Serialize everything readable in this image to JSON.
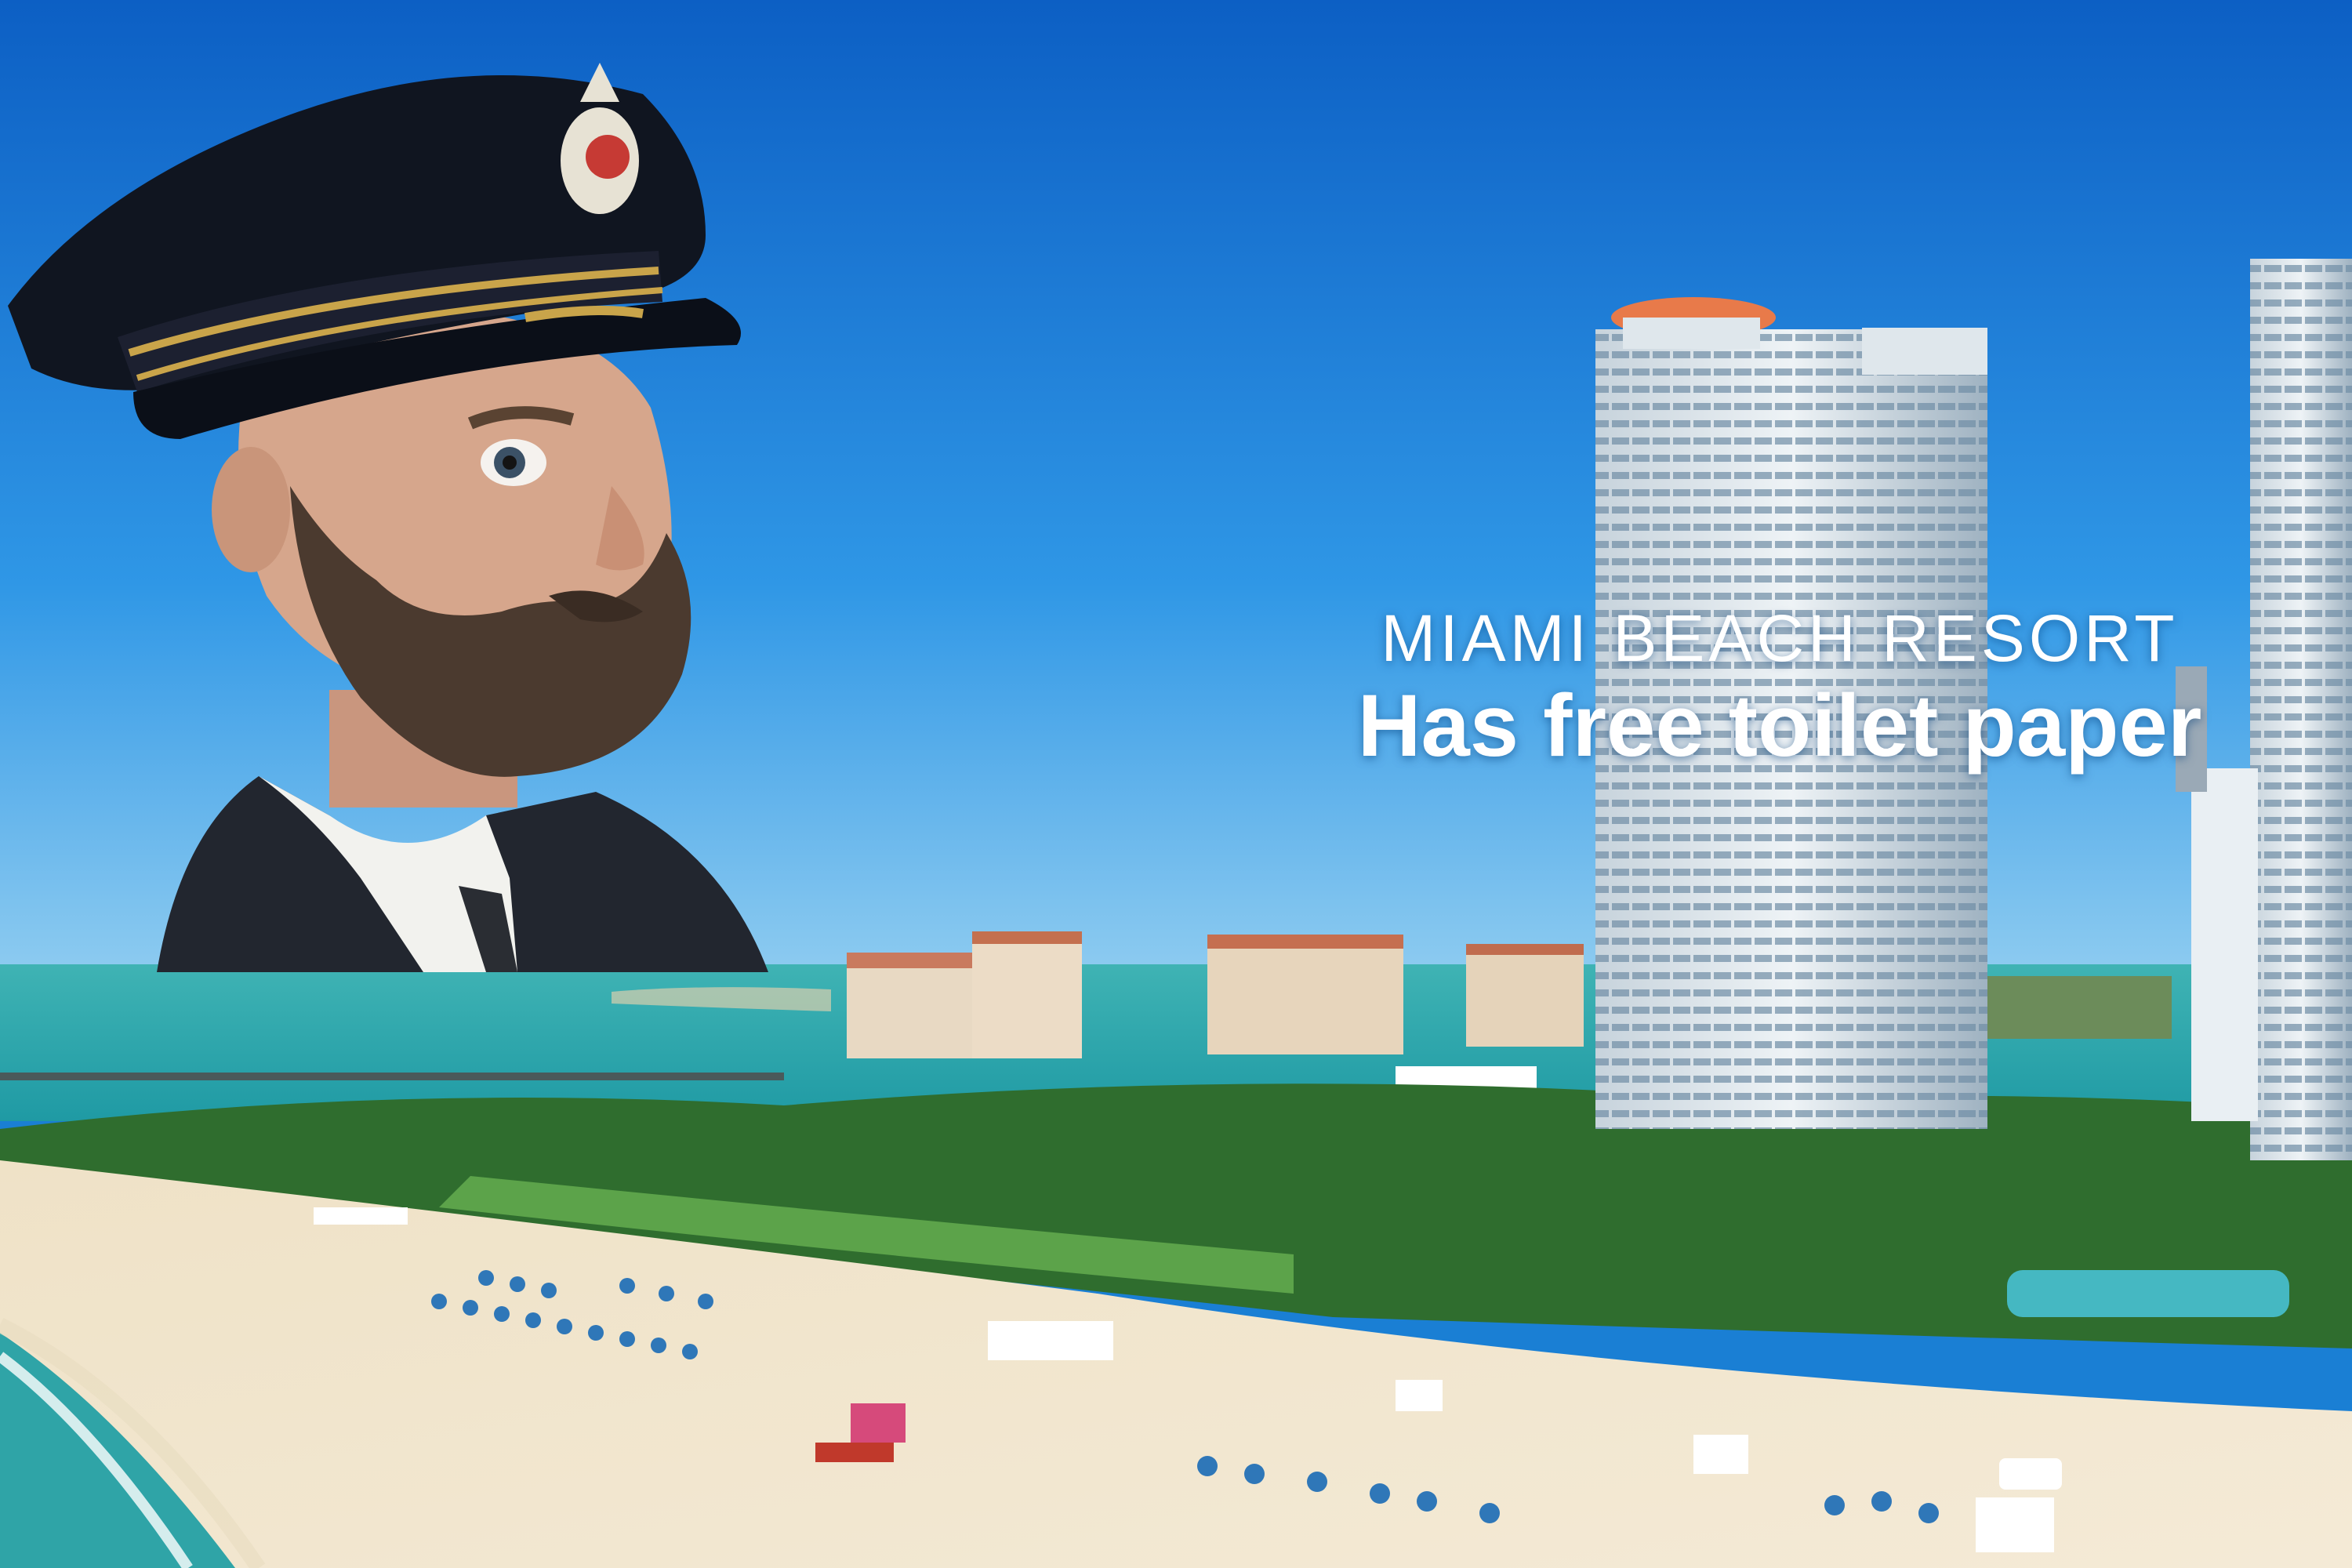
{
  "caption": {
    "line1": "MIAMI BEACH RESORT",
    "line2": "Has free toilet paper"
  }
}
